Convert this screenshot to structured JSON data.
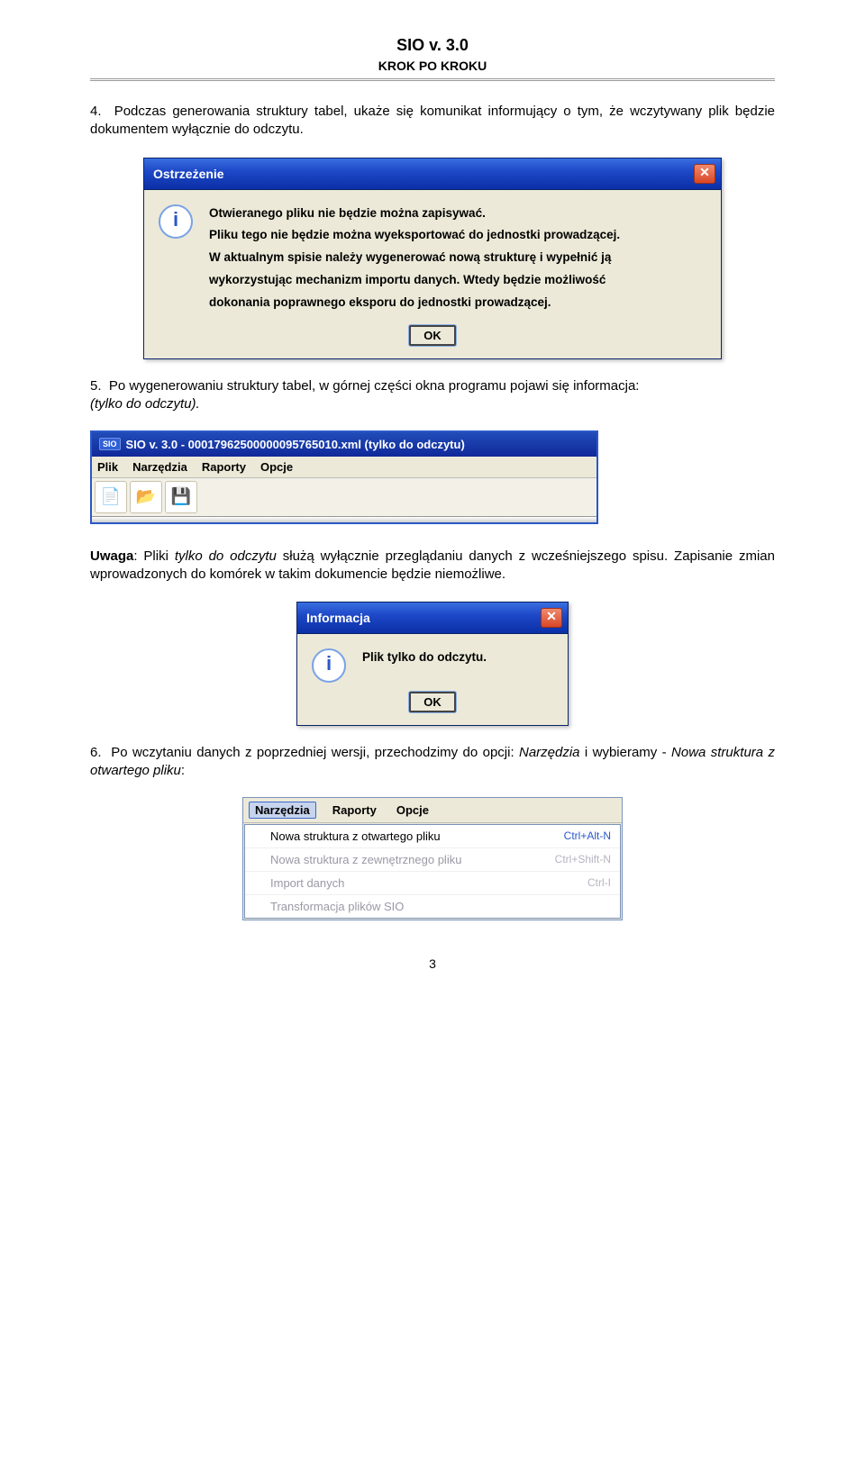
{
  "header": {
    "title": "SIO v. 3.0",
    "subtitle": "KROK PO KROKU"
  },
  "para4": "4.  Podczas generowania struktury tabel, ukaże się komunikat informujący o tym, że wczytywany plik będzie dokumentem wyłącznie do odczytu.",
  "warning": {
    "title": "Ostrzeżenie",
    "line1": "Otwieranego pliku nie będzie można zapisywać.",
    "line2": "Pliku tego nie będzie można wyeksportować do jednostki prowadzącej.",
    "line3": "W aktualnym spisie należy wygenerować nową strukturę i wypełnić ją",
    "line4": "wykorzystując mechanizm importu danych. Wtedy będzie możliwość",
    "line5": "dokonania poprawnego eksporu do jednostki prowadzącej.",
    "ok": "OK"
  },
  "para5_a": "5.  Po wygenerowaniu struktury tabel, w górnej części okna programu pojawi się informacja: ",
  "para5_b": "(tylko do odczytu).",
  "appbar": {
    "badge": "SIO",
    "title": "SIO v. 3.0 - 00017962500000095765010.xml (tylko do odczytu)",
    "m1": "Plik",
    "m2": "Narzędzia",
    "m3": "Raporty",
    "m4": "Opcje"
  },
  "note": {
    "prefix": "Uwaga",
    "mid1": ": Pliki ",
    "it1": "tylko do odczytu",
    "mid2": " służą wyłącznie przeglądaniu danych z wcześniejszego spisu. Zapisanie zmian wprowadzonych do komórek w takim dokumencie będzie niemożliwe."
  },
  "info": {
    "title": "Informacja",
    "msg": "Plik tylko do odczytu.",
    "ok": "OK"
  },
  "para6_a": "6.  Po wczytaniu danych z poprzedniej wersji, przechodzimy do opcji: ",
  "para6_b": "Narzędzia",
  "para6_c": " i wybieramy - ",
  "para6_d": "Nowa struktura z otwartego pliku",
  "para6_e": ":",
  "ctx": {
    "m1": "Narzędzia",
    "m2": "Raporty",
    "m3": "Opcje",
    "i1": "Nowa struktura z otwartego pliku",
    "s1": "Ctrl+Alt-N",
    "i2": "Nowa struktura z zewnętrznego  pliku",
    "s2": "Ctrl+Shift-N",
    "i3": "Import danych",
    "s3": "Ctrl-I",
    "i4": "Transformacja plików SIO"
  },
  "pagenum": "3"
}
